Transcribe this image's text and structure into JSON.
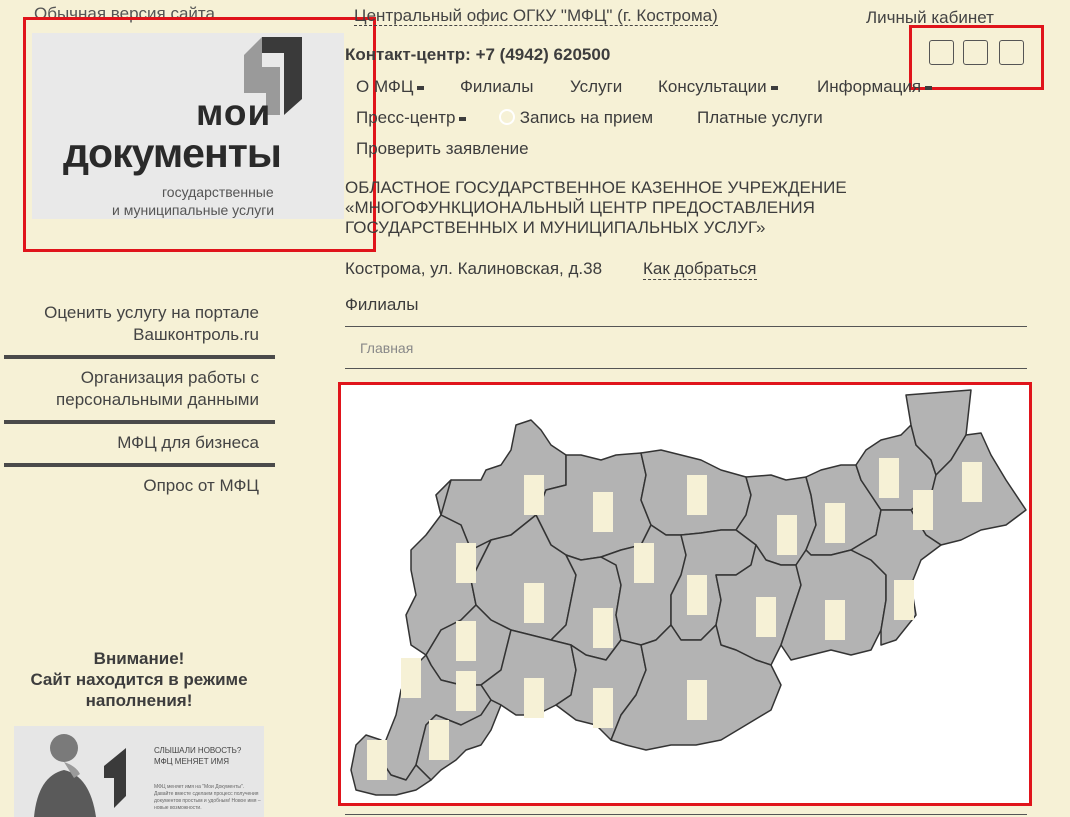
{
  "top": {
    "normal_version": "Обычная версия сайта",
    "office": "Центральный офис ОГКУ \"МФЦ\" (г. Кострома)",
    "office_icon": "",
    "cabinet": "Личный кабинет",
    "contact": "Контакт-центр: +7 (4942) 620500",
    "icons": [
      "",
      "",
      ""
    ]
  },
  "logo": {
    "line1": "мои",
    "line2": "документы",
    "line3": "государственные",
    "line4": "и муниципальные услуги"
  },
  "nav": {
    "items": [
      {
        "label": "О МФЦ"
      },
      {
        "label": "Филиалы"
      },
      {
        "label": "Услуги"
      },
      {
        "label": "Консультации"
      },
      {
        "label": "Информация"
      },
      {
        "label": "Пресс-центр"
      },
      {
        "label": "Запись на прием"
      },
      {
        "label": "Платные услуги"
      },
      {
        "label": "Проверить заявление"
      }
    ]
  },
  "org": {
    "line1": "ОБЛАСТНОЕ ГОСУДАРСТВЕННОЕ КАЗЕННОЕ УЧРЕЖДЕНИЕ",
    "line2": "«МНОГОФУНКЦИОНАЛЬНЫЙ ЦЕНТР ПРЕДОСТАВЛЕНИЯ",
    "line3": "ГОСУДАРСТВЕННЫХ И МУНИЦИПАЛЬНЫХ УСЛУГ»",
    "address": "Кострома, ул. Калиновская, д.38",
    "route": "Как добраться"
  },
  "branches_label": "Филиалы",
  "breadcrumb": "Главная",
  "sidebar": {
    "links": [
      {
        "line1": "Оценить услугу на портале",
        "line2": "Вашконтроль.ru"
      },
      {
        "line1": "Организация работы с",
        "line2": "персональными данными"
      },
      {
        "line1": "МФЦ для бизнеса",
        "line2": ""
      },
      {
        "line1": "Опрос от МФЦ",
        "line2": ""
      }
    ],
    "warning": {
      "line1": "Внимание!",
      "line2": "Сайт находится в режиме",
      "line3": "наполнения!"
    }
  },
  "banner": {
    "title": "СЛЫШАЛИ НОВОСТЬ?",
    "subtitle": "МФЦ МЕНЯЕТ ИМЯ",
    "text": "МФЦ меняет имя на \"Мои Документы\". Давайте вместе сделаем процесс получения документов простым и удобным! Новое имя – новые возможности."
  },
  "colors": {
    "background": "#f6f1d6",
    "highlight_frame": "#e0141b",
    "map_region": "#b3b3b3",
    "map_marker": "#f6f1d6"
  }
}
